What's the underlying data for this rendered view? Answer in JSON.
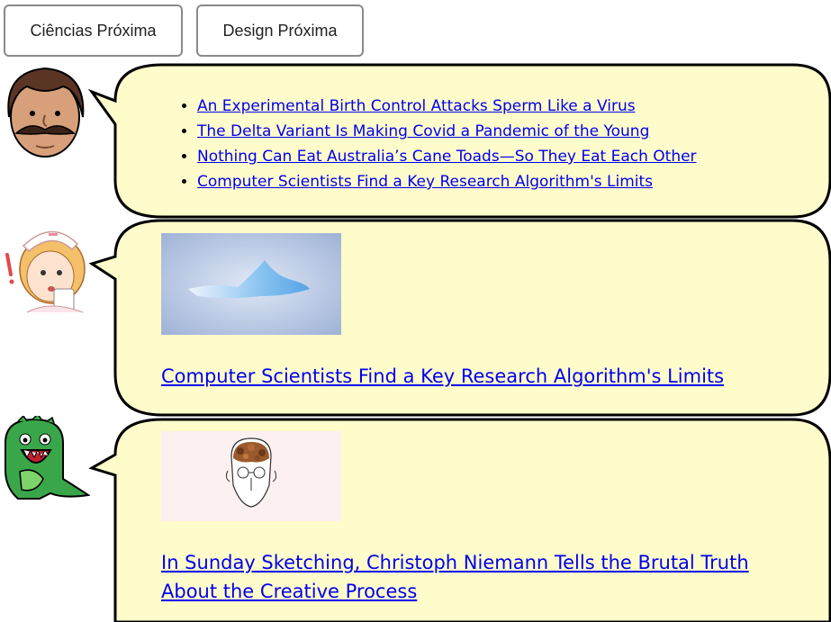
{
  "buttons": {
    "science_next": "Ciências Próxima",
    "design_next": "Design Próxima"
  },
  "bubble1": {
    "links": [
      "An Experimental Birth Control Attacks Sperm Like a Virus",
      "The Delta Variant Is Making Covid a Pandemic of the Young",
      "Nothing Can Eat Australia’s Cane Toads—So They Eat Each Other",
      "Computer Scientists Find a Key Research Algorithm's Limits"
    ]
  },
  "bubble2": {
    "title": "Computer Scientists Find a Key Research Algorithm's Limits"
  },
  "bubble3": {
    "title": "In Sunday Sketching, Christoph Niemann Tells the Brutal Truth About the Creative Process"
  },
  "colors": {
    "bubble_fill": "#fffccb",
    "bubble_stroke": "#000000",
    "link": "#0000ee"
  }
}
